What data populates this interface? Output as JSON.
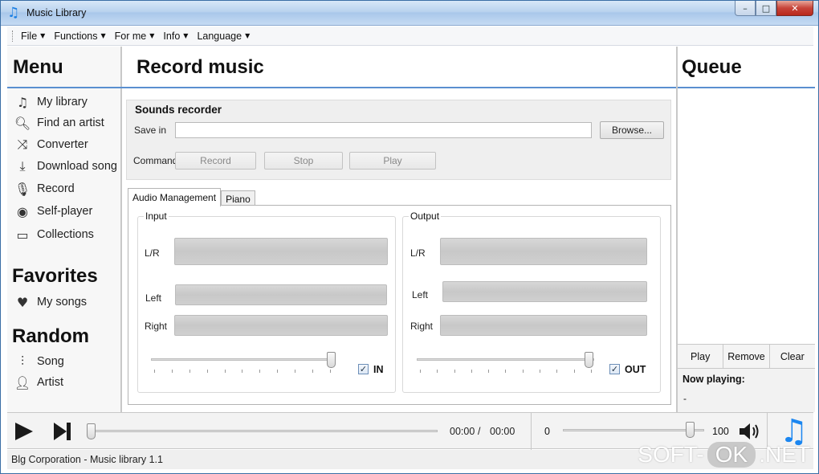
{
  "window": {
    "title": "Music Library",
    "minimize": "–",
    "maximize": "□",
    "close": "✕"
  },
  "menubar": [
    {
      "label": "File"
    },
    {
      "label": "Functions"
    },
    {
      "label": "For me"
    },
    {
      "label": "Info"
    },
    {
      "label": "Language"
    }
  ],
  "left": {
    "menu_title": "Menu",
    "items": [
      {
        "label": "My library",
        "icon": "music-note-icon"
      },
      {
        "label": "Find an artist",
        "icon": "search-icon"
      },
      {
        "label": "Converter",
        "icon": "shuffle-icon"
      },
      {
        "label": "Download song",
        "icon": "download-icon"
      },
      {
        "label": "Record",
        "icon": "microphone-icon"
      },
      {
        "label": "Self-player",
        "icon": "disc-icon"
      },
      {
        "label": "Collections",
        "icon": "folder-icon"
      }
    ],
    "favorites_title": "Favorites",
    "favorites": [
      {
        "label": "My songs",
        "icon": "heart-icon"
      }
    ],
    "random_title": "Random",
    "random": [
      {
        "label": "Song",
        "icon": "waveform-icon"
      },
      {
        "label": "Artist",
        "icon": "person-icon"
      }
    ]
  },
  "center": {
    "title": "Record music",
    "recorder": {
      "title": "Sounds recorder",
      "save_in_label": "Save in",
      "save_in_value": "",
      "browse_label": "Browse...",
      "command_label": "Command",
      "record_label": "Record",
      "stop_label": "Stop",
      "play_label": "Play"
    },
    "tabs": [
      {
        "label": "Audio Management",
        "active": true
      },
      {
        "label": "Piano",
        "active": false
      }
    ],
    "input": {
      "title": "Input",
      "lr": "L/R",
      "left": "Left",
      "right": "Right",
      "checkbox_label": "IN",
      "checked": true,
      "slider_value": 1.0
    },
    "output": {
      "title": "Output",
      "lr": "L/R",
      "left": "Left",
      "right": "Right",
      "checkbox_label": "OUT",
      "checked": true,
      "slider_value": 1.0
    }
  },
  "right": {
    "title": "Queue",
    "play_label": "Play",
    "remove_label": "Remove",
    "clear_label": "Clear",
    "now_playing_label": "Now playing:",
    "now_playing_value": "-"
  },
  "player": {
    "elapsed": "00:00",
    "separator": "/",
    "total": "00:00",
    "progress": 0,
    "volume_min": "0",
    "volume_max": "100",
    "volume": 0.9
  },
  "status": {
    "text": "Blg Corporation - Music library 1.1"
  },
  "watermark": {
    "left": "SOFT-",
    "mid": "OK",
    "right": ".NET"
  }
}
